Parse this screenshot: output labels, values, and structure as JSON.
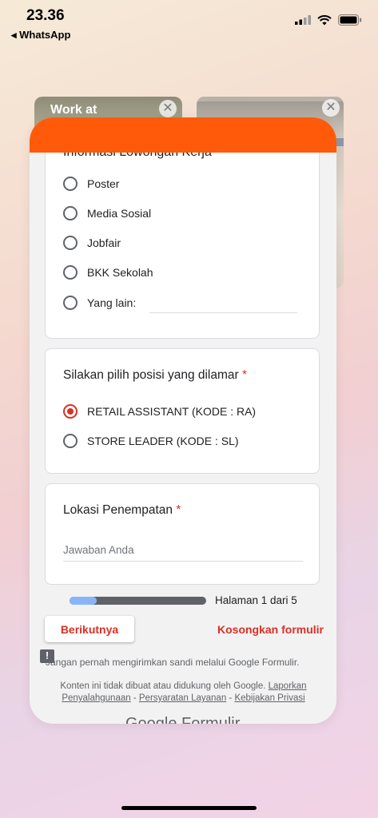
{
  "status_bar": {
    "time": "23.36",
    "back_app": "WhatsApp"
  },
  "background_cards": {
    "left_title": "Work at"
  },
  "form": {
    "q1": {
      "title_cut": "Informasi Lowongan Kerja",
      "options": [
        {
          "label": "Poster"
        },
        {
          "label": "Media Sosial"
        },
        {
          "label": "Jobfair"
        },
        {
          "label": "BKK Sekolah"
        },
        {
          "label": "Yang lain:"
        }
      ]
    },
    "q2": {
      "title": "Silakan pilih posisi yang dilamar",
      "required_mark": "*",
      "options": [
        {
          "label": "RETAIL ASSISTANT (KODE : RA)",
          "selected": true
        },
        {
          "label": "STORE LEADER (KODE : SL)",
          "selected": false
        }
      ]
    },
    "q3": {
      "title": "Lokasi Penempatan",
      "required_mark": "*",
      "placeholder": "Jawaban Anda"
    },
    "progress": {
      "text": "Halaman 1 dari 5",
      "fraction": 0.2
    },
    "buttons": {
      "next": "Berikutnya",
      "clear": "Kosongkan formulir"
    },
    "warning": "Jangan pernah mengirimkan sandi melalui Google Formulir.",
    "disclaimer": {
      "text": "Konten ini tidak dibuat atau didukung oleh Google.",
      "report": "Laporkan Penyalahgunaan",
      "sep1": " - ",
      "terms": "Persyaratan Layanan",
      "sep2": " - ",
      "privacy": "Kebijakan Privasi"
    },
    "brand": "Google Formulir"
  },
  "colors": {
    "header": "#ff5a0a",
    "accent": "#d93025",
    "progress_fill": "#8ab4f8"
  }
}
